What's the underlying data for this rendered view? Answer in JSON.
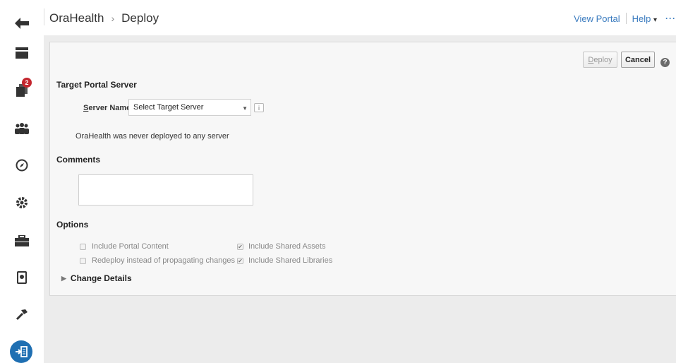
{
  "header": {
    "app_name": "OraHealth",
    "page_title": "Deploy",
    "view_portal": "View Portal",
    "help": "Help",
    "help_caret": "▾",
    "more": "···"
  },
  "rail": {
    "notification_count": "2"
  },
  "toolbar": {
    "deploy_prefix": "D",
    "deploy_rest": "eploy",
    "cancel_label": "Cancel",
    "help_glyph": "?"
  },
  "target": {
    "section_title": "Target Portal Server",
    "label_prefix": "S",
    "label_rest": "erver Name",
    "select_value": "Select Target Server",
    "message": "OraHealth was never deployed to any server"
  },
  "comments": {
    "section_title": "Comments",
    "value": ""
  },
  "options": {
    "section_title": "Options",
    "items": [
      {
        "label": "Include Portal Content",
        "checked": false
      },
      {
        "label": "Redeploy instead of propagating changes",
        "checked": false
      },
      {
        "label": "Include Shared Assets",
        "checked": true
      },
      {
        "label": "Include Shared Libraries",
        "checked": true
      }
    ]
  },
  "change_details": {
    "label": "Change Details"
  },
  "colors": {
    "link": "#3a7bbf",
    "badge": "#c4262e",
    "rail_active": "#1f6fb2"
  }
}
